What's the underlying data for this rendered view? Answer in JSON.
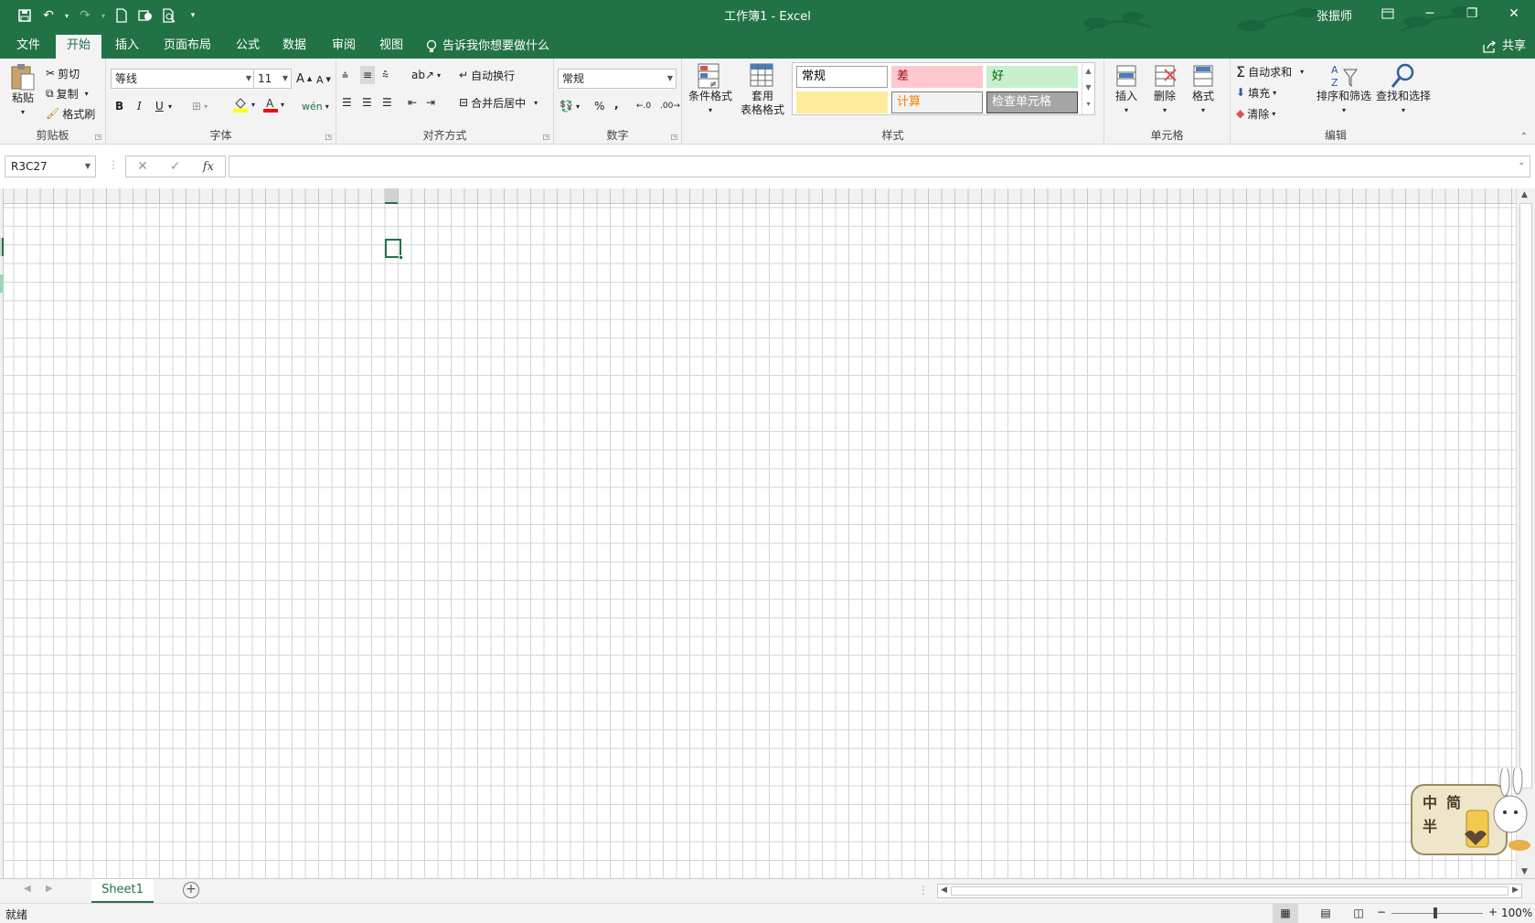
{
  "titlebar": {
    "title": "工作簿1  -  Excel",
    "user": "张振师"
  },
  "tabs": [
    "文件",
    "开始",
    "插入",
    "页面布局",
    "公式",
    "数据",
    "审阅",
    "视图"
  ],
  "tell_me": "告诉我你想要做什么",
  "share": "共享",
  "clipboard": {
    "paste": "粘贴",
    "cut": "剪切",
    "copy": "复制",
    "format_painter": "格式刷",
    "label": "剪贴板"
  },
  "font": {
    "name": "等线",
    "size": "11",
    "bold": "B",
    "italic": "I",
    "underline": "U",
    "label": "字体"
  },
  "alignment": {
    "wrap": "自动换行",
    "merge": "合并后居中",
    "label": "对齐方式"
  },
  "number": {
    "format": "常规",
    "percent": "%",
    "comma": ",",
    "label": "数字"
  },
  "styles": {
    "conditional": "条件格式",
    "table_format_1": "套用",
    "table_format_2": "表格格式",
    "cells": [
      {
        "text": "常规",
        "bg": "#ffffff",
        "fg": "#000000",
        "border": "#9e9e9e"
      },
      {
        "text": "差",
        "bg": "#ffc7ce",
        "fg": "#9c0006",
        "border": "#ffc7ce"
      },
      {
        "text": "好",
        "bg": "#c6efce",
        "fg": "#006100",
        "border": "#c6efce"
      },
      {
        "text": "",
        "bg": "#ffeb9c",
        "fg": "#9c5700",
        "border": "#ffeb9c"
      },
      {
        "text": "计算",
        "bg": "#f2f2f2",
        "fg": "#fa7d00",
        "border": "#7f7f7f"
      },
      {
        "text": "检查单元格",
        "bg": "#a5a5a5",
        "fg": "#ffffff",
        "border": "#3f3f3f"
      }
    ],
    "label": "样式"
  },
  "cells": {
    "insert": "插入",
    "delete": "删除",
    "format": "格式",
    "label": "单元格"
  },
  "editing": {
    "autosum": "自动求和",
    "fill": "填充",
    "clear": "清除",
    "sort": "排序和筛选",
    "find": "查找和选择",
    "label": "编辑"
  },
  "formula_bar": {
    "name_box": "R3C27",
    "fx": "fx",
    "value": ""
  },
  "sheets": [
    "Sheet1"
  ],
  "status": {
    "ready": "就绪",
    "zoom": "100%"
  },
  "sticker_text": [
    "中",
    "简",
    "半"
  ],
  "colors": {
    "brand": "#217346"
  }
}
